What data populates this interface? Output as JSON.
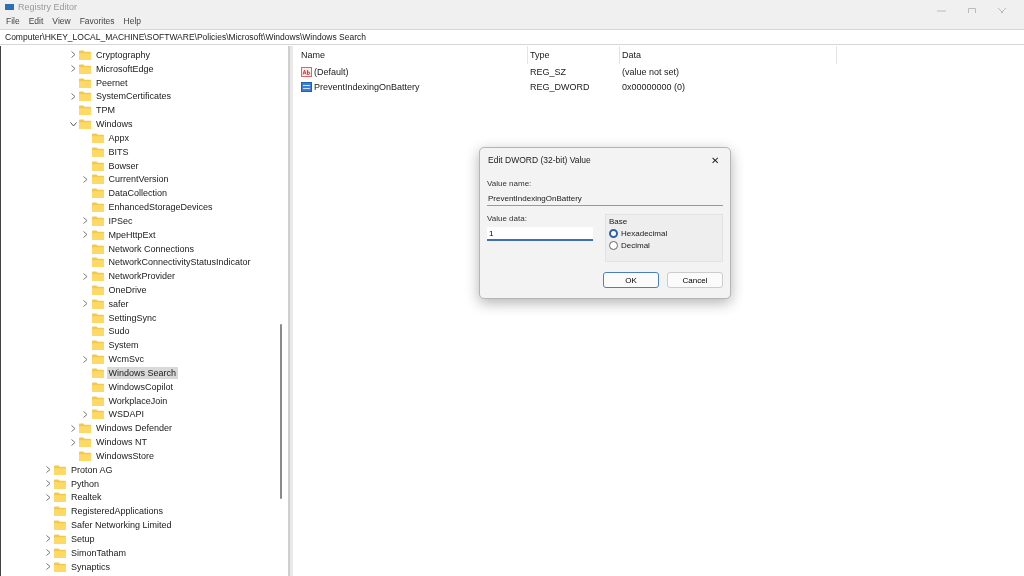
{
  "window": {
    "title": "Registry Editor"
  },
  "menu": [
    "File",
    "Edit",
    "View",
    "Favorites",
    "Help"
  ],
  "address": "Computer\\HKEY_LOCAL_MACHINE\\SOFTWARE\\Policies\\Microsoft\\Windows\\Windows Search",
  "tree": {
    "items": [
      {
        "children": [
          {
            "children": [
              {
                "label": "Cryptography",
                "expandable": true,
                "expanded": false,
                "selected": false
              },
              {
                "label": "MicrosoftEdge",
                "expandable": true,
                "expanded": false,
                "selected": false
              },
              {
                "label": "Peernet",
                "expandable": false,
                "selected": false
              },
              {
                "label": "SystemCertificates",
                "expandable": true,
                "expanded": false,
                "selected": false
              },
              {
                "label": "TPM",
                "expandable": false,
                "selected": false
              },
              {
                "label": "Windows",
                "expandable": true,
                "expanded": true,
                "selected": false,
                "children": [
                  {
                    "label": "Appx",
                    "expandable": false,
                    "selected": false
                  },
                  {
                    "label": "BITS",
                    "expandable": false,
                    "selected": false
                  },
                  {
                    "label": "Bowser",
                    "expandable": false,
                    "selected": false
                  },
                  {
                    "label": "CurrentVersion",
                    "expandable": true,
                    "expanded": false,
                    "selected": false
                  },
                  {
                    "label": "DataCollection",
                    "expandable": false,
                    "selected": false
                  },
                  {
                    "label": "EnhancedStorageDevices",
                    "expandable": false,
                    "selected": false
                  },
                  {
                    "label": "IPSec",
                    "expandable": true,
                    "expanded": false,
                    "selected": false
                  },
                  {
                    "label": "MpeHttpExt",
                    "expandable": true,
                    "expanded": false,
                    "selected": false
                  },
                  {
                    "label": "Network Connections",
                    "expandable": false,
                    "selected": false
                  },
                  {
                    "label": "NetworkConnectivityStatusIndicator",
                    "expandable": false,
                    "selected": false
                  },
                  {
                    "label": "NetworkProvider",
                    "expandable": true,
                    "expanded": false,
                    "selected": false
                  },
                  {
                    "label": "OneDrive",
                    "expandable": false,
                    "selected": false
                  },
                  {
                    "label": "safer",
                    "expandable": true,
                    "expanded": false,
                    "selected": false
                  },
                  {
                    "label": "SettingSync",
                    "expandable": false,
                    "selected": false
                  },
                  {
                    "label": "Sudo",
                    "expandable": false,
                    "selected": false
                  },
                  {
                    "label": "System",
                    "expandable": false,
                    "selected": false
                  },
                  {
                    "label": "WcmSvc",
                    "expandable": true,
                    "expanded": false,
                    "selected": false
                  },
                  {
                    "label": "Windows Search",
                    "expandable": false,
                    "selected": true
                  },
                  {
                    "label": "WindowsCopilot",
                    "expandable": false,
                    "selected": false
                  },
                  {
                    "label": "WorkplaceJoin",
                    "expandable": false,
                    "selected": false
                  },
                  {
                    "label": "WSDAPI",
                    "expandable": true,
                    "expanded": false,
                    "selected": false
                  }
                ]
              },
              {
                "label": "Windows Defender",
                "expandable": true,
                "expanded": false,
                "selected": false
              },
              {
                "label": "Windows NT",
                "expandable": true,
                "expanded": false,
                "selected": false
              },
              {
                "label": "WindowsStore",
                "expandable": false,
                "selected": false
              }
            ]
          }
        ]
      },
      {
        "label": "Proton AG",
        "expandable": true,
        "expanded": false,
        "selected": false
      },
      {
        "label": "Python",
        "expandable": true,
        "expanded": false,
        "selected": false
      },
      {
        "label": "Realtek",
        "expandable": true,
        "expanded": false,
        "selected": false
      },
      {
        "label": "RegisteredApplications",
        "expandable": false,
        "selected": false
      },
      {
        "label": "Safer Networking Limited",
        "expandable": false,
        "selected": false
      },
      {
        "label": "Setup",
        "expandable": true,
        "expanded": false,
        "selected": false
      },
      {
        "label": "SimonTatham",
        "expandable": true,
        "expanded": false,
        "selected": false
      },
      {
        "label": "Synaptics",
        "expandable": true,
        "expanded": false,
        "selected": false
      }
    ]
  },
  "values": {
    "columns": [
      "Name",
      "Type",
      "Data"
    ],
    "rows": [
      {
        "kind": "string",
        "name": "(Default)",
        "type": "REG_SZ",
        "data": "(value not set)"
      },
      {
        "kind": "binary",
        "name": "PreventIndexingOnBattery",
        "type": "REG_DWORD",
        "data": "0x00000000 (0)"
      }
    ]
  },
  "dialog": {
    "title": "Edit DWORD (32-bit) Value",
    "close": "✕",
    "value_name_label": "Value name:",
    "value_name": "PreventIndexingOnBattery",
    "value_data_label": "Value data:",
    "value_data": "1",
    "base": {
      "label": "Base",
      "options": [
        {
          "label": "Hexadecimal",
          "selected": true
        },
        {
          "label": "Decimal",
          "selected": false
        }
      ]
    },
    "buttons": [
      {
        "label": "OK",
        "default": true
      },
      {
        "label": "Cancel",
        "default": false
      }
    ]
  }
}
